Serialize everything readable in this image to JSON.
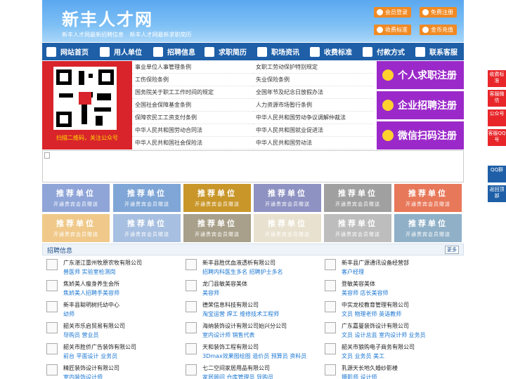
{
  "header": {
    "logo": "新丰人才网",
    "links": [
      "新丰人才网最新招聘信息",
      "新丰人才网最新求职简历"
    ],
    "buttons": [
      {
        "label": "会员登录",
        "name": "login-button"
      },
      {
        "label": "免费注册",
        "name": "register-button"
      },
      {
        "label": "收费标准",
        "name": "fee-button"
      },
      {
        "label": "金币充值",
        "name": "recharge-button"
      }
    ]
  },
  "nav": [
    {
      "label": "网站首页",
      "icon": "home-icon"
    },
    {
      "label": "用人单位",
      "icon": "building-icon"
    },
    {
      "label": "招聘信息",
      "icon": "megaphone-icon"
    },
    {
      "label": "求职简历",
      "icon": "resume-icon"
    },
    {
      "label": "职场资讯",
      "icon": "news-icon"
    },
    {
      "label": "收费标准",
      "icon": "money-icon"
    },
    {
      "label": "付款方式",
      "icon": "card-icon"
    },
    {
      "label": "联系客服",
      "icon": "phone-icon"
    }
  ],
  "qr": {
    "caption": "扫描二维码，关注公众号"
  },
  "regulations": [
    "事业单位人事管理条例",
    "女职工劳动保护特别规定",
    "工伤保险条例",
    "失业保险条例",
    "国务院关于职工工作时间的规定",
    "全国年节及纪念日放假办法",
    "全国社会保障基金条例",
    "人力资源市场暂行条例",
    "保障农民工工资支付条例",
    "中华人民共和国劳动争议调解仲裁法",
    "中华人民共和国劳动合同法",
    "中华人民共和国就业促进法",
    "中华人民共和国社会保险法",
    "中华人民共和国劳动法"
  ],
  "register_buttons": [
    "个人求职注册",
    "企业招聘注册",
    "微信扫码注册"
  ],
  "side_float": [
    "收费标准",
    "客服微信",
    "公众号",
    "客服QQ号",
    "QQ群",
    "返回顶部"
  ],
  "recommend": {
    "title": "推荐单位",
    "subtitle": "开通贵宾会员赠送",
    "colors": [
      "#8fa5d8",
      "#7fa6d6",
      "#c9962a",
      "#8e92c2",
      "#a0a0a0",
      "#e8785a",
      "#f0c98a",
      "#a7bfe0",
      "#a8a08a",
      "#e9e1cf",
      "#bdbdbd",
      "#8fb0c7"
    ]
  },
  "jobs": {
    "title": "招聘信息",
    "more": "更多",
    "items": [
      {
        "company": "广东湛江雷州牧原农牧有限公司",
        "positions": "兽医师 实验室检测岗"
      },
      {
        "company": "新丰县胜优血液透析有限公司",
        "positions": "招聘内科医生多名 招聘护士多名"
      },
      {
        "company": "新丰县广源通讯设备经营部",
        "positions": "客户经理"
      },
      {
        "company": "焦娇美人瘦身养生会所",
        "positions": "焦娇美人招聘手美容师"
      },
      {
        "company": "龙门县敏美容美体",
        "positions": "美容师"
      },
      {
        "company": "登敏美容美体",
        "positions": "美容师 店长美容师"
      },
      {
        "company": "新丰县聪明树托幼中心",
        "positions": "幼师"
      },
      {
        "company": "德荣信息科技有限公司",
        "positions": "淘宝运营 焊工 维修技术工程师"
      },
      {
        "company": "中实龙校教育管理有限公司",
        "positions": "文员 物理老师 英语教师"
      },
      {
        "company": "韶关市乐启贸易有限公司",
        "positions": "导购员 营业员"
      },
      {
        "company": "海纳装饰设计有限公司始兴分公司",
        "positions": "室内设计师 销售代表"
      },
      {
        "company": "广东嘉曼装饰设计有限公司",
        "positions": "文员 设计总监 室内设计师 业务员"
      },
      {
        "company": "韶关市胜侨广告装饰有限公司",
        "positions": "前台 平面设计 业务员"
      },
      {
        "company": "天和装饰工程有限公司",
        "positions": "3Dmax效果图绘图 造价员 预算员 资料员"
      },
      {
        "company": "韶关市狼购电子商务有限公司",
        "positions": "文员 业务员 美工"
      },
      {
        "company": "精匠装饰设计有限公司",
        "positions": "室内装饰设计师"
      },
      {
        "company": "七二空间家居用品有限公司",
        "positions": "家居顾问 仓库管理员 导购员"
      },
      {
        "company": "乳源天长地久婚纱影楼",
        "positions": "摄影师 设计师"
      }
    ]
  }
}
